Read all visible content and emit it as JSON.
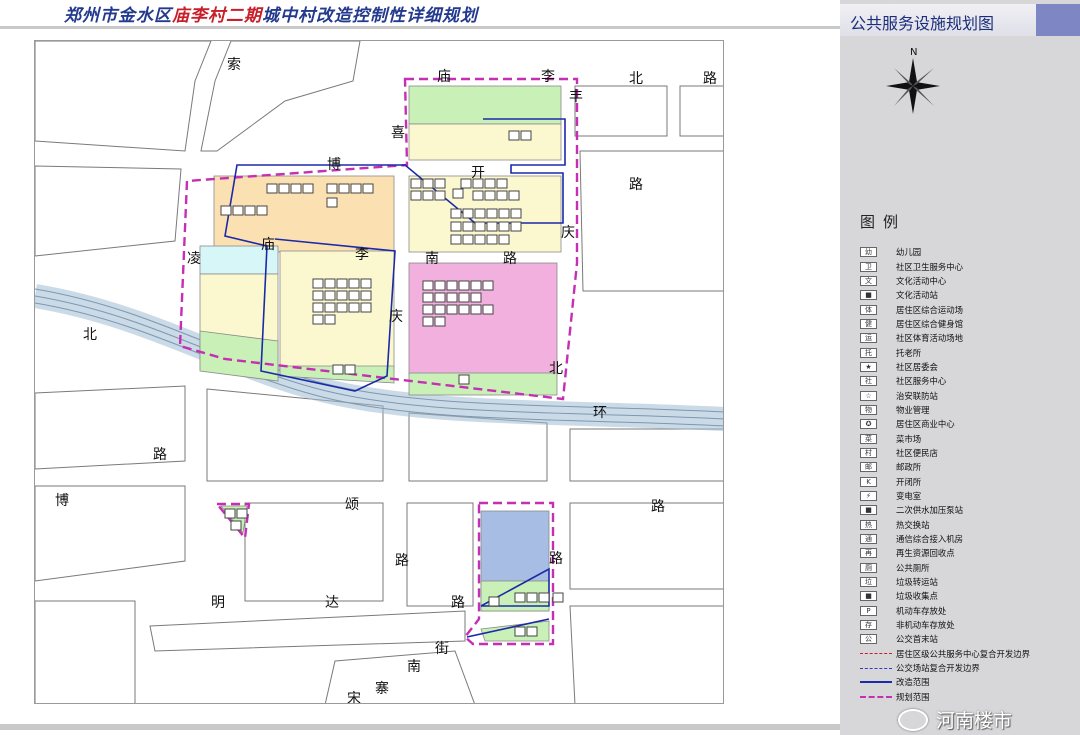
{
  "header": {
    "title_part1": "郑州市金水区",
    "title_highlight": "庙李村二期",
    "title_part2": "城中村改造控制性详细规划"
  },
  "panel": {
    "title": "公共服务设施规划图",
    "compass_label": "N",
    "legend_title": "图例",
    "legend_items": [
      {
        "symbol": "幼",
        "label": "幼儿园"
      },
      {
        "symbol": "卫",
        "label": "社区卫生服务中心"
      },
      {
        "symbol": "文",
        "label": "文化活动中心"
      },
      {
        "symbol": "■",
        "label": "文化活动站"
      },
      {
        "symbol": "体",
        "label": "居住区综合运动场"
      },
      {
        "symbol": "健",
        "label": "居住区综合健身馆"
      },
      {
        "symbol": "运",
        "label": "社区体育活动场地"
      },
      {
        "symbol": "托",
        "label": "托老所"
      },
      {
        "symbol": "★",
        "label": "社区居委会"
      },
      {
        "symbol": "社",
        "label": "社区服务中心"
      },
      {
        "symbol": "☆",
        "label": "治安联防站"
      },
      {
        "symbol": "物",
        "label": "物业管理"
      },
      {
        "symbol": "✪",
        "label": "居住区商业中心"
      },
      {
        "symbol": "菜",
        "label": "菜市场"
      },
      {
        "symbol": "村",
        "label": "社区便民店"
      },
      {
        "symbol": "邮",
        "label": "邮政所"
      },
      {
        "symbol": "K",
        "label": "开闭所"
      },
      {
        "symbol": "⚡",
        "label": "变电室"
      },
      {
        "symbol": "■",
        "label": "二次供水加压泵站"
      },
      {
        "symbol": "热",
        "label": "热交换站"
      },
      {
        "symbol": "通",
        "label": "通信综合接入机房"
      },
      {
        "symbol": "再",
        "label": "再生资源回收点"
      },
      {
        "symbol": "厕",
        "label": "公共厕所"
      },
      {
        "symbol": "垃",
        "label": "垃圾转运站"
      },
      {
        "symbol": "■",
        "label": "垃圾收集点"
      },
      {
        "symbol": "P",
        "label": "机动车存放处"
      },
      {
        "symbol": "存",
        "label": "非机动车存放处"
      },
      {
        "symbol": "公",
        "label": "公交首末站"
      }
    ],
    "line_items": [
      {
        "style": "red-dash",
        "label": "居住区级公共服务中心复合开发边界"
      },
      {
        "style": "blue-dash",
        "label": "公交场站复合开发边界"
      },
      {
        "style": "blue-solid",
        "label": "改造范围"
      },
      {
        "style": "magenta-dash",
        "label": "规划范围"
      }
    ]
  },
  "map": {
    "road_chars": [
      {
        "text": "索"
      },
      {
        "text": "庙"
      },
      {
        "text": "李"
      },
      {
        "text": "丰"
      },
      {
        "text": "北"
      },
      {
        "text": "路"
      },
      {
        "text": "博"
      },
      {
        "text": "喜"
      },
      {
        "text": "开"
      },
      {
        "text": "路"
      },
      {
        "text": "庆"
      },
      {
        "text": "凌"
      },
      {
        "text": "庙"
      },
      {
        "text": "李"
      },
      {
        "text": "南"
      },
      {
        "text": "路"
      },
      {
        "text": "庆"
      },
      {
        "text": "北"
      },
      {
        "text": "北"
      },
      {
        "text": "环"
      },
      {
        "text": "路"
      },
      {
        "text": "博"
      },
      {
        "text": "颂"
      },
      {
        "text": "路"
      },
      {
        "text": "路"
      },
      {
        "text": "路"
      },
      {
        "text": "明"
      },
      {
        "text": "达"
      },
      {
        "text": "路"
      },
      {
        "text": "南"
      },
      {
        "text": "街"
      },
      {
        "text": "宋"
      },
      {
        "text": "寨"
      }
    ]
  },
  "watermark": {
    "text": "河南楼市"
  },
  "colors": {
    "park_green": "#c9f0b6",
    "residential_yellow": "#fbf7cf",
    "education_orange": "#fbe0b2",
    "commercial_pink": "#f2b0de",
    "water_cyan": "#d7f6f8",
    "transport_blue": "#a8bde4",
    "boundary_magenta": "#c52fb4",
    "reform_blue": "#1b2aa8",
    "title_blue": "#1c2d7a",
    "title_red": "#c8202a"
  }
}
